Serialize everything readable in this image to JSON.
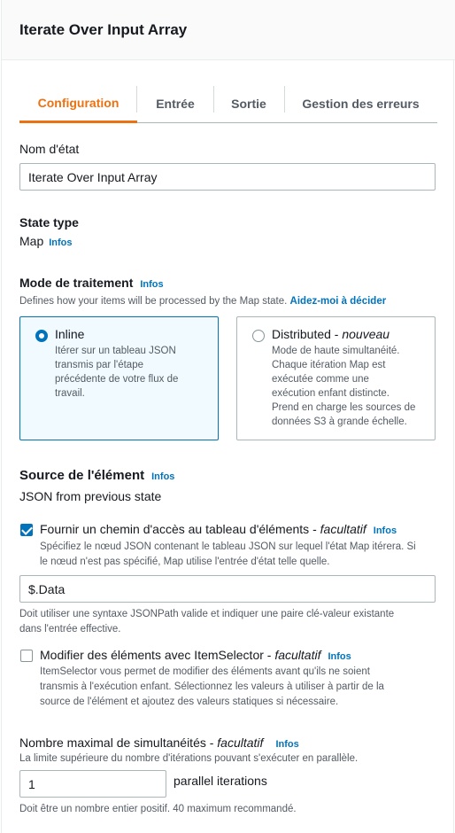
{
  "header": {
    "title": "Iterate Over Input Array"
  },
  "tabs": [
    {
      "label": "Configuration"
    },
    {
      "label": "Entrée"
    },
    {
      "label": "Sortie"
    },
    {
      "label": "Gestion des erreurs"
    }
  ],
  "info_label": "Infos",
  "state_name": {
    "label": "Nom d'état",
    "value": "Iterate Over Input Array"
  },
  "state_type": {
    "label": "State type",
    "value": "Map"
  },
  "processing_mode": {
    "label": "Mode de traitement",
    "description": "Defines how your items will be processed by the Map state.",
    "help_link": "Aidez-moi à décider",
    "inline": {
      "title": "Inline",
      "lines": [
        "Itérer sur un tableau JSON",
        "transmis par l'étape",
        "précédente de votre flux de",
        "travail."
      ]
    },
    "distributed": {
      "title": "Distributed - ",
      "title_badge": "nouveau",
      "lines": [
        "Mode de haute simultanéité.",
        "Chaque itération Map est",
        "exécutée comme une",
        "exécution enfant distincte.",
        "Prend en charge les sources de",
        "données S3 à grande échelle."
      ]
    }
  },
  "item_source": {
    "label": "Source de l'élément",
    "value": "JSON from previous state"
  },
  "items_path": {
    "label": "Fournir un chemin d'accès au tableau d'éléments - ",
    "optional": "facultatif",
    "checked": true,
    "description_1": "Spécifiez le nœud JSON contenant le tableau JSON sur lequel l'état Map itérera. Si",
    "description_2": "le nœud n'est pas spécifié, Map utilise l'entrée d'état telle quelle.",
    "value": "$.Data",
    "hint_1": "Doit utiliser une syntaxe JSONPath valide et indiquer une paire clé-valeur existante",
    "hint_2": "dans l'entrée effective."
  },
  "item_selector": {
    "label": "Modifier des éléments avec ItemSelector - ",
    "optional": "facultatif",
    "checked": false,
    "description_1": "ItemSelector vous permet de modifier des éléments avant qu'ils ne soient",
    "description_2": "transmis à l'exécution enfant. Sélectionnez les valeurs à utiliser à partir de la",
    "description_3": "source de l'élément et ajoutez des valeurs statiques si nécessaire."
  },
  "max_concurrency": {
    "label": "Nombre maximal de simultanéités - ",
    "optional": "facultatif",
    "description": "La limite supérieure du nombre d'itérations pouvant s'exécuter en parallèle.",
    "value": "1",
    "suffix": "parallel iterations",
    "hint": "Doit être un nombre entier positif. 40 maximum recommandé."
  }
}
